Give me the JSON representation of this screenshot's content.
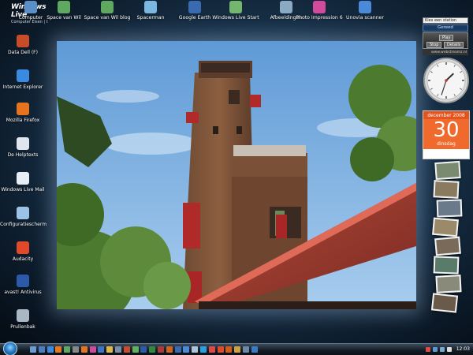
{
  "windows_live": {
    "brand": "Windows Live",
    "sub": "Computer  Eisen  |  t"
  },
  "top_icons": [
    {
      "label": "Computer",
      "icon": "computer-icon",
      "color": "#5b8fc7"
    },
    {
      "label": "Space van Wil",
      "icon": "people-icon",
      "color": "#5fa85f"
    },
    {
      "label": "Space van Wil blog",
      "icon": "people-icon",
      "color": "#5fa85f"
    },
    {
      "label": "Spacerman",
      "icon": "monitor-icon",
      "color": "#7ab8e0"
    },
    {
      "label": "Google Earth",
      "icon": "globe-icon",
      "color": "#3a6bb0"
    },
    {
      "label": "Windows Live Start",
      "icon": "house-icon",
      "color": "#74b66c"
    },
    {
      "label": "Afbeeldingen",
      "icon": "pictures-icon",
      "color": "#8aa9c2"
    },
    {
      "label": "Photo Impression 6",
      "icon": "photo-icon",
      "color": "#d24a9b"
    },
    {
      "label": "Unovia scanner",
      "icon": "scanner-icon",
      "color": "#4a8ad8"
    }
  ],
  "left_icons": [
    {
      "label": "Data Dell (F)",
      "icon": "drive-icon",
      "color": "#c84b2a"
    },
    {
      "label": "Internet Explorer",
      "icon": "ie-icon",
      "color": "#3a8ae0"
    },
    {
      "label": "Mozilla Firefox",
      "icon": "firefox-icon",
      "color": "#e8731e"
    },
    {
      "label": "De Helptexts",
      "icon": "document-icon",
      "color": "#dfe6ee"
    },
    {
      "label": "Windows Live Mail",
      "icon": "mail-icon",
      "color": "#e8eef5"
    },
    {
      "label": "Configuratiescherm",
      "icon": "control-panel-icon",
      "color": "#9cc2e5"
    },
    {
      "label": "Audacity",
      "icon": "audacity-icon",
      "color": "#e04a2a"
    },
    {
      "label": "avast! Antivirus",
      "icon": "avast-icon",
      "color": "#2d5aa8"
    },
    {
      "label": "Prullenbak",
      "icon": "recycle-bin-icon",
      "color": "#aab8c6"
    }
  ],
  "gadgets": {
    "station_dropdown": "Kies een station",
    "status": "Gereed",
    "play_label": "Play",
    "stop_label": "Stop",
    "details_label": "Details",
    "url": "www.webstreamz.nl",
    "clock": {
      "hour": 1,
      "minute": 33
    },
    "calendar": {
      "month": "december 2008",
      "day": "30",
      "weekday": "dinsdag"
    }
  },
  "taskbar": {
    "time": "12:03",
    "quick_launch": [
      {
        "icon": "desktop-icon",
        "color": "#6d9ad0"
      },
      {
        "icon": "windows-flip-icon",
        "color": "#4b7cc0"
      },
      {
        "icon": "ie-icon",
        "color": "#3a8ae0"
      },
      {
        "icon": "media-player-icon",
        "color": "#e87a1e"
      },
      {
        "icon": "mail-icon",
        "color": "#5fa85f"
      },
      {
        "icon": "gear-icon",
        "color": "#888888"
      },
      {
        "icon": "firefox-icon",
        "color": "#e8731e"
      },
      {
        "icon": "photo-icon",
        "color": "#d24a9b"
      },
      {
        "icon": "music-icon",
        "color": "#3d75c4"
      },
      {
        "icon": "folder-icon",
        "color": "#e0b848"
      },
      {
        "icon": "calculator-icon",
        "color": "#7a8fa5"
      },
      {
        "icon": "paint-icon",
        "color": "#c84b2a"
      },
      {
        "icon": "messenger-icon",
        "color": "#5fb05f"
      },
      {
        "icon": "word-icon",
        "color": "#2d5aa8"
      },
      {
        "icon": "excel-icon",
        "color": "#2f8a3f"
      },
      {
        "icon": "access-icon",
        "color": "#a83a3a"
      },
      {
        "icon": "powerpoint-icon",
        "color": "#d4621f"
      },
      {
        "icon": "google-earth-icon",
        "color": "#3a6bb0"
      },
      {
        "icon": "scanner-icon",
        "color": "#4a8ad8"
      },
      {
        "icon": "notepad-icon",
        "color": "#b0c4d8"
      },
      {
        "icon": "skype-icon",
        "color": "#2aa0e0"
      },
      {
        "icon": "picasa-icon",
        "color": "#e04848"
      },
      {
        "icon": "audacity-icon",
        "color": "#e04a2a"
      },
      {
        "icon": "avast-icon",
        "color": "#d45a1a"
      },
      {
        "icon": "winamp-icon",
        "color": "#d0a040"
      },
      {
        "icon": "network-icon",
        "color": "#6a8aa8"
      },
      {
        "icon": "help-icon",
        "color": "#3a7ac8"
      }
    ],
    "tray": [
      {
        "icon": "chat-icon",
        "color": "#e04848"
      },
      {
        "icon": "shield-icon",
        "color": "#5a9ad0"
      },
      {
        "icon": "network-icon",
        "color": "#7aaad0"
      },
      {
        "icon": "volume-icon",
        "color": "#dddddd"
      }
    ]
  }
}
